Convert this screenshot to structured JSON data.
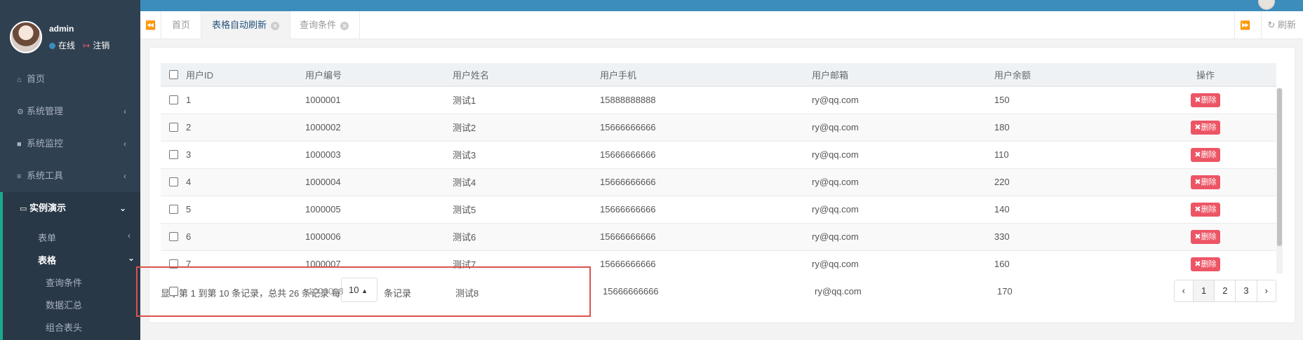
{
  "sidebar": {
    "user": {
      "name": "admin",
      "status": "在线",
      "logout": "注销"
    },
    "menu": [
      {
        "label": "首页",
        "icon": "home-icon"
      },
      {
        "label": "系统管理",
        "icon": "gear-icon"
      },
      {
        "label": "系统监控",
        "icon": "video-icon"
      },
      {
        "label": "系统工具",
        "icon": "bars-icon"
      },
      {
        "label": "实例演示",
        "icon": "desktop-icon"
      }
    ],
    "sub": {
      "form": "表单",
      "table": "表格"
    },
    "subsub": [
      "查询条件",
      "数据汇总",
      "组合表头"
    ]
  },
  "tabs": {
    "home": "首页",
    "items": [
      "表格自动刷新",
      "查询条件"
    ],
    "refresh": "刷新"
  },
  "table": {
    "headers": [
      "用户ID",
      "用户编号",
      "用户姓名",
      "用户手机",
      "用户邮箱",
      "用户余额",
      "操作"
    ],
    "delete_label": "删除",
    "rows": [
      [
        "1",
        "1000001",
        "测试1",
        "15888888888",
        "ry@qq.com",
        "150"
      ],
      [
        "2",
        "1000002",
        "测试2",
        "15666666666",
        "ry@qq.com",
        "180"
      ],
      [
        "3",
        "1000003",
        "测试3",
        "15666666666",
        "ry@qq.com",
        "110"
      ],
      [
        "4",
        "1000004",
        "测试4",
        "15666666666",
        "ry@qq.com",
        "220"
      ],
      [
        "5",
        "1000005",
        "测试5",
        "15666666666",
        "ry@qq.com",
        "140"
      ],
      [
        "6",
        "1000006",
        "测试6",
        "15666666666",
        "ry@qq.com",
        "330"
      ],
      [
        "7",
        "1000007",
        "测试7",
        "15666666666",
        "ry@qq.com",
        "160"
      ]
    ],
    "overflow_row": [
      "8",
      "1000008",
      "测试8",
      "15666666666",
      "ry@qq.com",
      "170"
    ]
  },
  "footer": {
    "info": "显示第 1 到第 10 条记录，总共 26 条记录 每页显示",
    "page_size": "10",
    "unit": "条记录",
    "pages": [
      "‹",
      "1",
      "2",
      "3",
      "›"
    ]
  },
  "colors": {
    "sidebar": "#2f4050",
    "accent": "#19aa8d",
    "danger": "#ed5565",
    "topbar": "#3c8dbc"
  }
}
